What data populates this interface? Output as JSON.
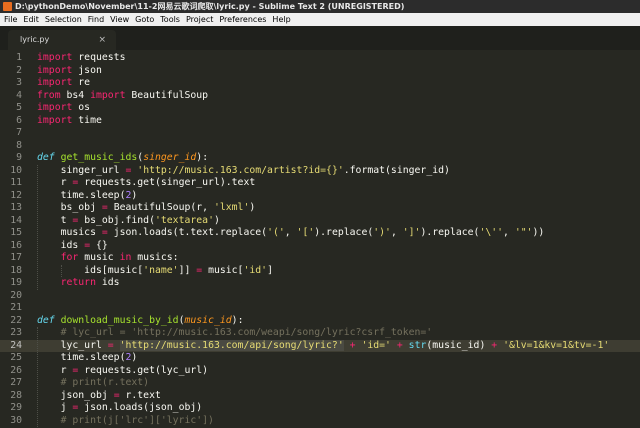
{
  "window": {
    "title": "D:\\pythonDemo\\November\\11-2网易云歌词爬取\\lyric.py - Sublime Text 2 (UNREGISTERED)"
  },
  "menu": [
    "File",
    "Edit",
    "Selection",
    "Find",
    "View",
    "Goto",
    "Tools",
    "Project",
    "Preferences",
    "Help"
  ],
  "tab": {
    "label": "lyric.py",
    "close": "×"
  },
  "colors": {
    "background": "#272822",
    "keyword": "#f92672",
    "string": "#e6db74",
    "comment": "#75715e",
    "function": "#a6e22e"
  },
  "current_line": 24,
  "lines": [
    {
      "n": "1",
      "tokens": [
        [
          "k",
          "import"
        ],
        [
          "t",
          " requests"
        ]
      ]
    },
    {
      "n": "2",
      "tokens": [
        [
          "k",
          "import"
        ],
        [
          "t",
          " json"
        ]
      ]
    },
    {
      "n": "3",
      "tokens": [
        [
          "k",
          "import"
        ],
        [
          "t",
          " re"
        ]
      ]
    },
    {
      "n": "4",
      "tokens": [
        [
          "k",
          "from"
        ],
        [
          "t",
          " bs4 "
        ],
        [
          "k",
          "import"
        ],
        [
          "t",
          " BeautifulSoup"
        ]
      ]
    },
    {
      "n": "5",
      "tokens": [
        [
          "k",
          "import"
        ],
        [
          "t",
          " os"
        ]
      ]
    },
    {
      "n": "6",
      "tokens": [
        [
          "k",
          "import"
        ],
        [
          "t",
          " time"
        ]
      ]
    },
    {
      "n": "7",
      "tokens": []
    },
    {
      "n": "8",
      "tokens": []
    },
    {
      "n": "9",
      "tokens": [
        [
          "d",
          "def"
        ],
        [
          "t",
          " "
        ],
        [
          "f",
          "get_music_ids"
        ],
        [
          "t",
          "("
        ],
        [
          "p",
          "singer_id"
        ],
        [
          "t",
          "):"
        ]
      ]
    },
    {
      "n": "10",
      "tokens": [
        [
          "t",
          "    singer_url "
        ],
        [
          "k",
          "="
        ],
        [
          "t",
          " "
        ],
        [
          "s",
          "'http://music.163.com/artist?id={}'"
        ],
        [
          "t",
          ".format(singer_id)"
        ]
      ]
    },
    {
      "n": "11",
      "tokens": [
        [
          "t",
          "    r "
        ],
        [
          "k",
          "="
        ],
        [
          "t",
          " requests.get(singer_url).text"
        ]
      ]
    },
    {
      "n": "12",
      "tokens": [
        [
          "t",
          "    time.sleep("
        ],
        [
          "n",
          "2"
        ],
        [
          "t",
          ")"
        ]
      ]
    },
    {
      "n": "13",
      "tokens": [
        [
          "t",
          "    bs_obj "
        ],
        [
          "k",
          "="
        ],
        [
          "t",
          " BeautifulSoup(r, "
        ],
        [
          "s",
          "'lxml'"
        ],
        [
          "t",
          ")"
        ]
      ]
    },
    {
      "n": "14",
      "tokens": [
        [
          "t",
          "    t "
        ],
        [
          "k",
          "="
        ],
        [
          "t",
          " bs_obj.find("
        ],
        [
          "s",
          "'textarea'"
        ],
        [
          "t",
          ")"
        ]
      ]
    },
    {
      "n": "15",
      "tokens": [
        [
          "t",
          "    musics "
        ],
        [
          "k",
          "="
        ],
        [
          "t",
          " json.loads(t.text.replace("
        ],
        [
          "s",
          "'('"
        ],
        [
          "t",
          ", "
        ],
        [
          "s",
          "'['"
        ],
        [
          "t",
          ").replace("
        ],
        [
          "s",
          "')'"
        ],
        [
          "t",
          ", "
        ],
        [
          "s",
          "']'"
        ],
        [
          "t",
          ").replace("
        ],
        [
          "s",
          "'\\''"
        ],
        [
          "t",
          ", "
        ],
        [
          "s",
          "'\"'"
        ],
        [
          "t",
          "))"
        ]
      ]
    },
    {
      "n": "16",
      "tokens": [
        [
          "t",
          "    ids "
        ],
        [
          "k",
          "="
        ],
        [
          "t",
          " {}"
        ]
      ]
    },
    {
      "n": "17",
      "tokens": [
        [
          "t",
          "    "
        ],
        [
          "k",
          "for"
        ],
        [
          "t",
          " music "
        ],
        [
          "k",
          "in"
        ],
        [
          "t",
          " musics:"
        ]
      ]
    },
    {
      "n": "18",
      "tokens": [
        [
          "t",
          "        ids[music["
        ],
        [
          "s",
          "'name'"
        ],
        [
          "t",
          "]] "
        ],
        [
          "k",
          "="
        ],
        [
          "t",
          " music["
        ],
        [
          "s",
          "'id'"
        ],
        [
          "t",
          "]"
        ]
      ]
    },
    {
      "n": "19",
      "tokens": [
        [
          "t",
          "    "
        ],
        [
          "k",
          "return"
        ],
        [
          "t",
          " ids"
        ]
      ]
    },
    {
      "n": "20",
      "tokens": []
    },
    {
      "n": "21",
      "tokens": []
    },
    {
      "n": "22",
      "tokens": [
        [
          "d",
          "def"
        ],
        [
          "t",
          " "
        ],
        [
          "f",
          "download_music_by_id"
        ],
        [
          "t",
          "("
        ],
        [
          "p",
          "music_id"
        ],
        [
          "t",
          "):"
        ]
      ]
    },
    {
      "n": "23",
      "tokens": [
        [
          "c",
          "    # lyc_url = 'http://music.163.com/weapi/song/lyric?csrf_token='"
        ]
      ]
    },
    {
      "n": "24",
      "tokens": [
        [
          "t",
          "    lyc_url "
        ],
        [
          "k",
          "="
        ],
        [
          "t",
          " "
        ],
        [
          "sh",
          "'http://music.163.com/api/song/lyric?'"
        ],
        [
          "t",
          " "
        ],
        [
          "k",
          "+"
        ],
        [
          "t",
          " "
        ],
        [
          "s",
          "'id='"
        ],
        [
          "t",
          " "
        ],
        [
          "k",
          "+"
        ],
        [
          "t",
          " "
        ],
        [
          "b",
          "str"
        ],
        [
          "t",
          "(music_id) "
        ],
        [
          "k",
          "+"
        ],
        [
          "t",
          " "
        ],
        [
          "s",
          "'&lv=1&kv=1&tv=-1'"
        ]
      ]
    },
    {
      "n": "25",
      "tokens": [
        [
          "t",
          "    time.sleep("
        ],
        [
          "n",
          "2"
        ],
        [
          "t",
          ")"
        ]
      ]
    },
    {
      "n": "26",
      "tokens": [
        [
          "t",
          "    r "
        ],
        [
          "k",
          "="
        ],
        [
          "t",
          " requests.get(lyc_url)"
        ]
      ]
    },
    {
      "n": "27",
      "tokens": [
        [
          "c",
          "    # print(r.text)"
        ]
      ]
    },
    {
      "n": "28",
      "tokens": [
        [
          "t",
          "    json_obj "
        ],
        [
          "k",
          "="
        ],
        [
          "t",
          " r.text"
        ]
      ]
    },
    {
      "n": "29",
      "tokens": [
        [
          "t",
          "    j "
        ],
        [
          "k",
          "="
        ],
        [
          "t",
          " json.loads(json_obj)"
        ]
      ]
    },
    {
      "n": "30",
      "tokens": [
        [
          "c",
          "    # print(j['lrc']['lyric'])"
        ]
      ]
    }
  ]
}
